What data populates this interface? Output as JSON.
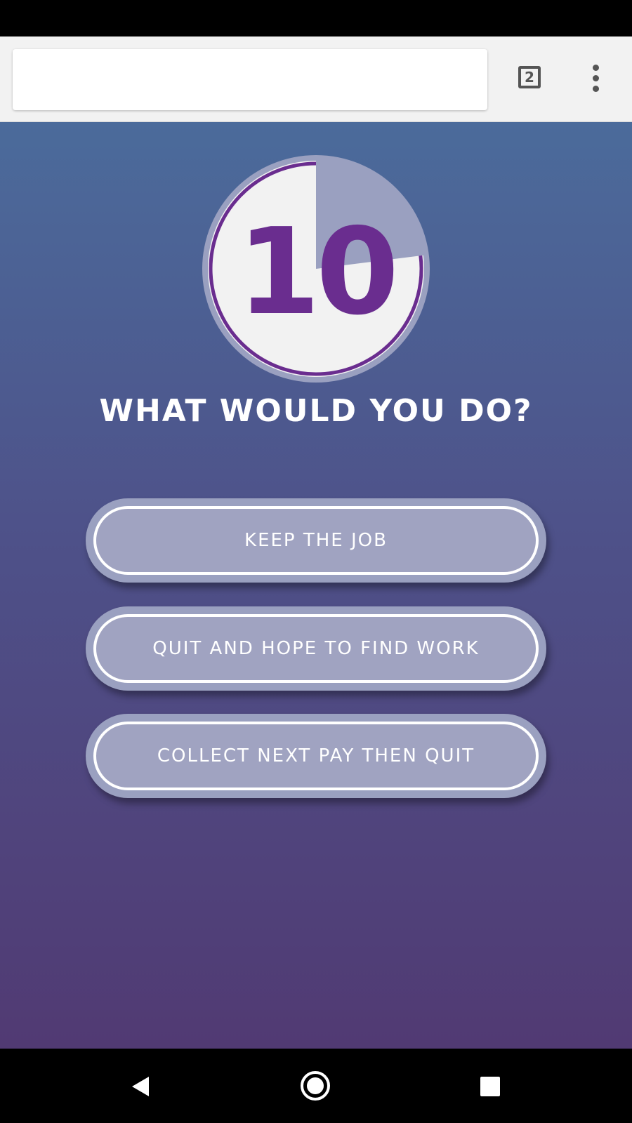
{
  "browser": {
    "url": "",
    "tab_count": "2"
  },
  "timer": {
    "value": "10",
    "remaining_fraction": 0.77,
    "colors": {
      "face": "#f2f2f2",
      "ring": "#6a2d8f",
      "elapsed": "#9aa0c0",
      "number": "#6a2d8f"
    }
  },
  "question": {
    "text": "WHAT WOULD YOU DO?"
  },
  "answers": [
    {
      "label": "KEEP THE JOB"
    },
    {
      "label": "QUIT AND HOPE TO FIND WORK"
    },
    {
      "label": "COLLECT NEXT PAY THEN QUIT"
    }
  ],
  "icons": {
    "menu": "more-vert-icon",
    "back": "back-triangle-icon",
    "home": "home-circle-icon",
    "recents": "recents-square-icon"
  }
}
